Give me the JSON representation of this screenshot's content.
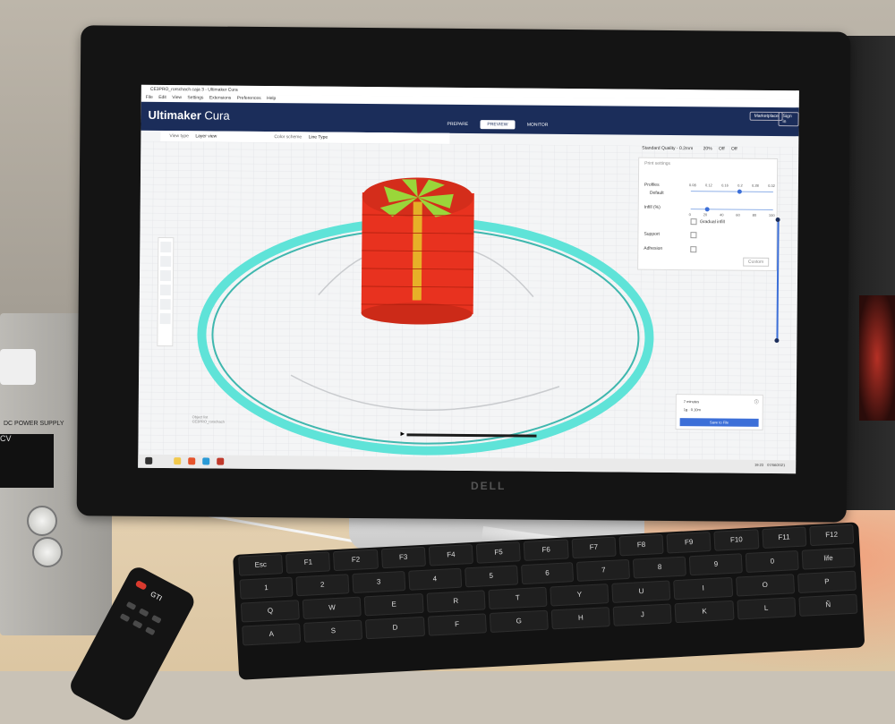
{
  "app": {
    "window_title": "CE3PRO_rorschach.caja 3 - Ultimaker Cura",
    "menu": [
      "File",
      "Edit",
      "View",
      "Settings",
      "Extensions",
      "Preferences",
      "Help"
    ],
    "logo_brand": "Ultimaker",
    "logo_product": "Cura",
    "stages": [
      {
        "label": "PREPARE",
        "active": false
      },
      {
        "label": "PREVIEW",
        "active": true
      },
      {
        "label": "MONITOR",
        "active": false
      }
    ],
    "marketplace_label": "Marketplace",
    "signin_label": "Sign in"
  },
  "view": {
    "view_type_label": "View type",
    "view_type_value": "Layer view",
    "color_scheme_label": "Color scheme",
    "color_scheme_value": "Line Type"
  },
  "quality_bar": {
    "quality": "Standard Quality - 0.2mm",
    "infill": "20%",
    "support": "Off",
    "adhesion": "Off"
  },
  "print_settings": {
    "title": "Print settings",
    "profiles_label": "Profiles",
    "profile_value": "Default",
    "layer_heights": [
      "0.08",
      "0.12",
      "0.16",
      "0.2",
      "0.28",
      "0.32"
    ],
    "infill_label": "Infill (%)",
    "infill_ticks": [
      "0",
      "20",
      "40",
      "60",
      "80",
      "100"
    ],
    "gradual_infill_label": "Gradual infill",
    "support_label": "Support",
    "adhesion_label": "Adhesion",
    "custom_button": "Custom"
  },
  "action_panel": {
    "time": "7 minutes",
    "material": "1g · 0.10m",
    "save_button": "Save to File"
  },
  "object_list": [
    "Object list",
    "CE3PRO_rorschach"
  ],
  "taskbar": {
    "clock": "19:23",
    "date": "07/06/2021"
  },
  "hardware": {
    "monitor_brand": "DELL",
    "remote_brand": "GTI",
    "psu_label": "DC POWER SUPPLY",
    "psu_readout": "CV",
    "keyboard_brand": "life"
  },
  "colors": {
    "header": "#1b2d5a",
    "model_wall": "#e8321f",
    "model_infill": "#9ad63a",
    "skirt": "#5fe3d8",
    "accent": "#3c6fd8"
  }
}
